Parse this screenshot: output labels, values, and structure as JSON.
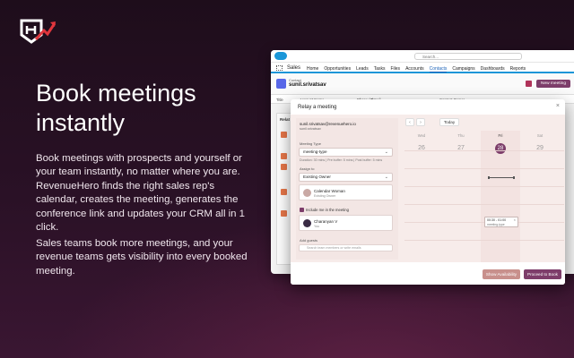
{
  "hero": {
    "headline": "Book meetings instantly",
    "para1": "Book meetings with prospects and yourself or your team instantly, no matter where you are. RevenueHero finds the right sales rep's calendar, creates the meeting, generates the conference link and updates your CRM all in 1 click.",
    "para2": "Sales teams book more meetings, and your revenue teams gets visibility into every booked meeting."
  },
  "colors": {
    "brand": "#7d3d6a",
    "logo_red": "#e0363d",
    "background": "#1f0e1c",
    "salesforce_blue": "#1b96d8"
  },
  "salesforce": {
    "search_placeholder": "Search...",
    "app_name": "Sales",
    "tabs": [
      "Home",
      "Opportunities",
      "Leads",
      "Tasks",
      "Files",
      "Accounts",
      "Contacts",
      "Campaigns",
      "Dashboards",
      "Reports"
    ],
    "active_tab": "Contacts",
    "record_label": "Contact",
    "record_name": "sunil.srivatsav",
    "new_meeting_label": "New meeting",
    "columns": [
      "Title",
      "Account Name",
      "Phone (2)",
      "Email",
      "Contact Owner"
    ],
    "side_label": "Relat"
  },
  "relay": {
    "title": "Relay a meeting",
    "close": "×",
    "email": "sunil.srivatsav@revenuehero.io",
    "username": "sunil.srivatsav",
    "meeting_type_label": "Meeting Type",
    "meeting_type_value": "meeting-type",
    "duration_note": "Duration: 30 mins | Pre buffer: 5 mins | Post buffer: 5 mins",
    "assign_to_label": "Assign to",
    "assign_to_value": "Existing Owner",
    "owner_name": "Calendar Woman",
    "owner_role": "Existing Owner",
    "include_label": "Include me in the meeting",
    "me_name": "Charanyan V",
    "me_sub": "You",
    "add_guests_label": "Add guests",
    "guest_placeholder": "Search team members or write emails",
    "today_label": "Today",
    "prev_icon": "‹",
    "next_icon": "›",
    "days": [
      {
        "name": "Wed",
        "date": "26"
      },
      {
        "name": "Thu",
        "date": "27"
      },
      {
        "name": "Fri",
        "date": "28"
      },
      {
        "name": "Sat",
        "date": "29"
      }
    ],
    "active_day": "28",
    "slot_time": "00:30 - 01:00",
    "slot_type": "meeting-type",
    "show_availability": "Show Availability",
    "proceed_to_book": "Proceed to Book"
  }
}
